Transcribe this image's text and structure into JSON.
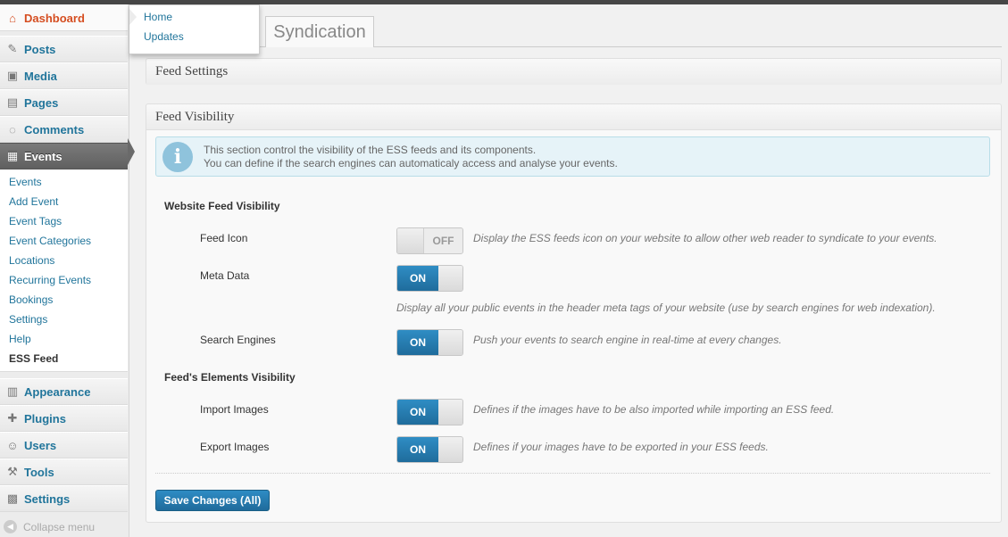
{
  "sidebar": {
    "items": [
      {
        "label": "Dashboard",
        "icon": "home-icon"
      },
      {
        "label": "Posts",
        "icon": "pin-icon"
      },
      {
        "label": "Media",
        "icon": "media-icon"
      },
      {
        "label": "Pages",
        "icon": "pages-icon"
      },
      {
        "label": "Comments",
        "icon": "comment-icon"
      },
      {
        "label": "Events",
        "icon": "calendar-icon"
      },
      {
        "label": "Appearance",
        "icon": "appearance-icon"
      },
      {
        "label": "Plugins",
        "icon": "plug-icon"
      },
      {
        "label": "Users",
        "icon": "users-icon"
      },
      {
        "label": "Tools",
        "icon": "tools-icon"
      },
      {
        "label": "Settings",
        "icon": "settings-icon"
      }
    ],
    "events_submenu": [
      "Events",
      "Add Event",
      "Event Tags",
      "Event Categories",
      "Locations",
      "Recurring Events",
      "Bookings",
      "Settings",
      "Help",
      "ESS Feed"
    ],
    "collapse_label": "Collapse menu"
  },
  "flyout": {
    "items": [
      "Home",
      "Updates"
    ]
  },
  "tabs": {
    "syndication": "Syndication"
  },
  "panels": {
    "feed_settings": {
      "title": "Feed Settings"
    },
    "feed_visibility": {
      "title": "Feed Visibility",
      "info_line1": "This section control the visibility of the ESS feeds and its components.",
      "info_line2": "You can define if the search engines can automaticaly access and analyse your events.",
      "website_section": "Website Feed Visibility",
      "elements_section": "Feed's Elements Visibility",
      "rows": {
        "feed_icon": {
          "label": "Feed Icon",
          "state": "OFF",
          "desc": "Display the ESS feeds icon on your website to allow other web reader to syndicate to your events."
        },
        "meta_data": {
          "label": "Meta Data",
          "state": "ON",
          "desc": "Display all your public events in the header meta tags of your website (use by search engines for web indexation)."
        },
        "search_engines": {
          "label": "Search Engines",
          "state": "ON",
          "desc": "Push your events to search engine in real-time at every changes."
        },
        "import_images": {
          "label": "Import Images",
          "state": "ON",
          "desc": "Defines if the images have to be also imported while importing an ESS feed."
        },
        "export_images": {
          "label": "Export Images",
          "state": "ON",
          "desc": "Defines if your images have to be exported in your ESS feeds."
        }
      },
      "save_label": "Save Changes (All)"
    }
  },
  "colors": {
    "link": "#21759b",
    "dashboard_active": "#d54e21",
    "button_blue": "#2478ac"
  }
}
